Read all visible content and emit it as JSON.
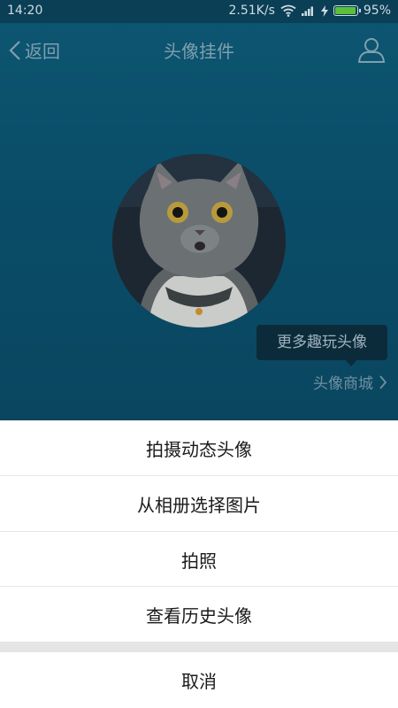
{
  "status_bar": {
    "time": "14:20",
    "network_speed": "2.51K/s",
    "battery_percent": "95%",
    "battery_level": 0.95
  },
  "nav": {
    "back_label": "返回",
    "title": "头像挂件"
  },
  "tooltip": {
    "text": "更多趣玩头像"
  },
  "store_link": {
    "label": "头像商城"
  },
  "action_sheet": {
    "items": [
      {
        "label": "拍摄动态头像"
      },
      {
        "label": "从相册选择图片"
      },
      {
        "label": "拍照"
      },
      {
        "label": "查看历史头像"
      }
    ],
    "cancel_label": "取消"
  },
  "colors": {
    "background": "#0a4d68",
    "status_bar": "#0a3f55",
    "nav_text": "#7f9faf",
    "sheet_bg": "#ffffff",
    "battery_fill": "#5cbf3a"
  },
  "icons": [
    "chevron-left-icon",
    "user-icon",
    "wifi-icon",
    "signal-icon",
    "charge-icon",
    "battery-icon",
    "chevron-right-icon",
    "cat-avatar"
  ]
}
